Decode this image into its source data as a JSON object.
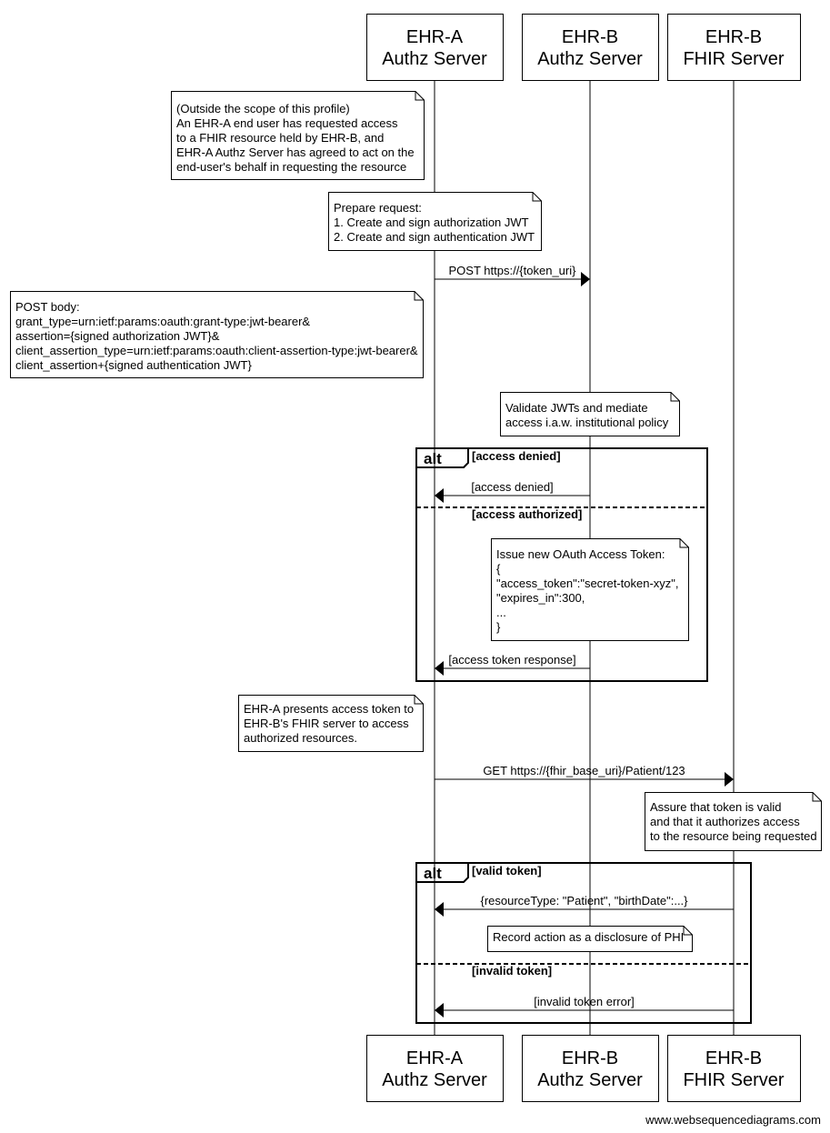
{
  "participants": [
    {
      "line1": "EHR-A",
      "line2": "Authz Server"
    },
    {
      "line1": "EHR-B",
      "line2": "Authz Server"
    },
    {
      "line1": "EHR-B",
      "line2": "FHIR Server"
    }
  ],
  "notes": [
    {
      "lines": [
        "(Outside the scope of this profile)",
        "An EHR-A end user has requested access",
        "to a FHIR resource held by EHR-B, and",
        "EHR-A Authz Server has agreed to act on the",
        "end-user's behalf in requesting the resource"
      ]
    },
    {
      "lines": [
        "Prepare request:",
        "1. Create and sign authorization JWT",
        "2. Create and sign authentication JWT"
      ]
    },
    {
      "lines": [
        "POST body:",
        "grant_type=urn:ietf:params:oauth:grant-type:jwt-bearer&",
        "assertion={signed authorization JWT}&",
        "client_assertion_type=urn:ietf:params:oauth:client-assertion-type:jwt-bearer&",
        "client_assertion+{signed authentication JWT}"
      ]
    },
    {
      "lines": [
        "Validate JWTs and mediate",
        "access i.a.w. institutional policy"
      ]
    },
    {
      "lines": [
        "Issue new OAuth Access Token:",
        "{",
        "\"access_token\":\"secret-token-xyz\",",
        "\"expires_in\":300,",
        "...",
        "}"
      ]
    },
    {
      "lines": [
        "EHR-A presents access token to",
        "EHR-B's FHIR server to access",
        "authorized resources."
      ]
    },
    {
      "lines": [
        "Assure that token is valid",
        "and that it authorizes access",
        "to the resource being requested"
      ]
    },
    {
      "lines": [
        "Record action as a disclosure of PHI"
      ]
    }
  ],
  "messages": [
    {
      "label": "POST https://{token_uri}",
      "from": 0,
      "to": 1
    },
    {
      "label": "[access denied]",
      "from": 1,
      "to": 0
    },
    {
      "label": "[access token response]",
      "from": 1,
      "to": 0
    },
    {
      "label": "GET https://{fhir_base_uri}/Patient/123",
      "from": 0,
      "to": 2
    },
    {
      "label": "{resourceType: \"Patient\", \"birthDate\":...}",
      "from": 2,
      "to": 0
    },
    {
      "label": "[invalid token error]",
      "from": 2,
      "to": 0
    }
  ],
  "alts": [
    {
      "keyword": "alt",
      "guards": [
        "[access denied]",
        "[access authorized]"
      ]
    },
    {
      "keyword": "alt",
      "guards": [
        "[valid token]",
        "[invalid token]"
      ]
    }
  ],
  "footer": "www.websequencediagrams.com"
}
